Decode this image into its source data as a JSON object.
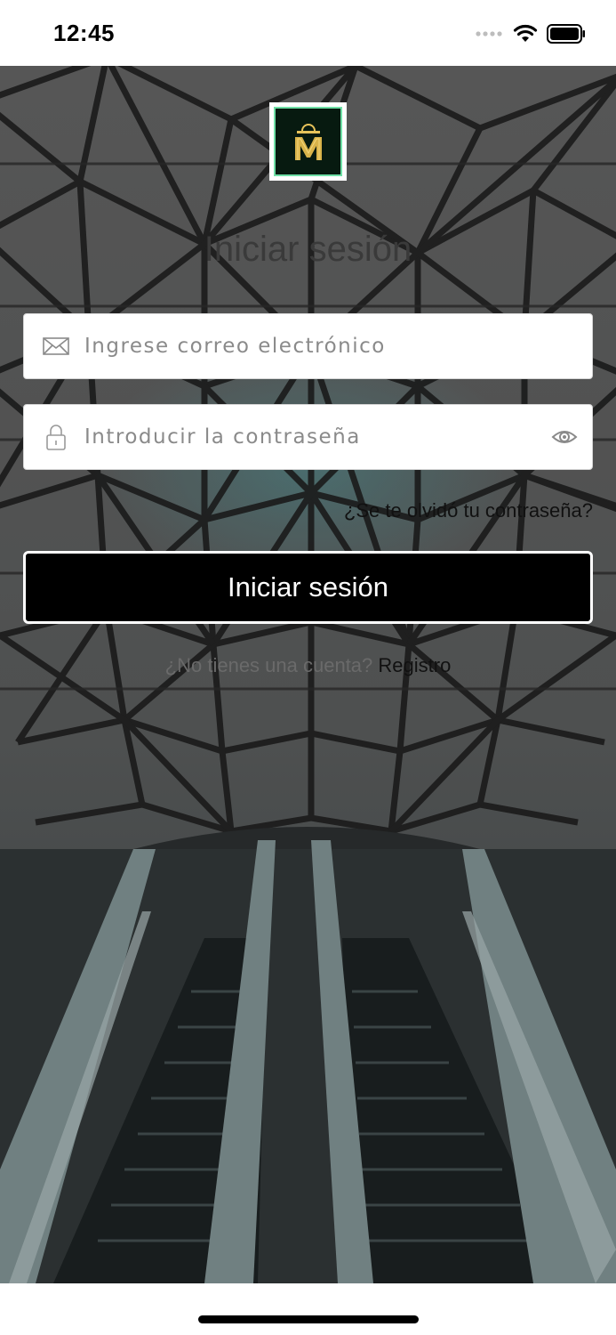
{
  "status_bar": {
    "time": "12:45",
    "signal_icon": "signal-dots-icon",
    "wifi_icon": "wifi-icon",
    "battery_icon": "battery-icon"
  },
  "logo": {
    "letter": "M",
    "icon": "shopping-bag-icon",
    "accent": "#d9b34a",
    "border": "#6fe0a6"
  },
  "title": "Iniciar sesión",
  "email": {
    "placeholder": "Ingrese correo electrónico",
    "value": "",
    "icon": "mail-icon"
  },
  "password": {
    "placeholder": "Introducir la contraseña",
    "value": "",
    "icon": "lock-icon",
    "toggle_icon": "eye-icon"
  },
  "forgot_password": "¿Se te olvidó tu contraseña?",
  "login_button": "Iniciar sesión",
  "register": {
    "question": "¿No tienes una cuenta?",
    "link": "Registro"
  },
  "colors": {
    "button_bg": "#000000",
    "button_text": "#ffffff",
    "background": "#575757"
  }
}
